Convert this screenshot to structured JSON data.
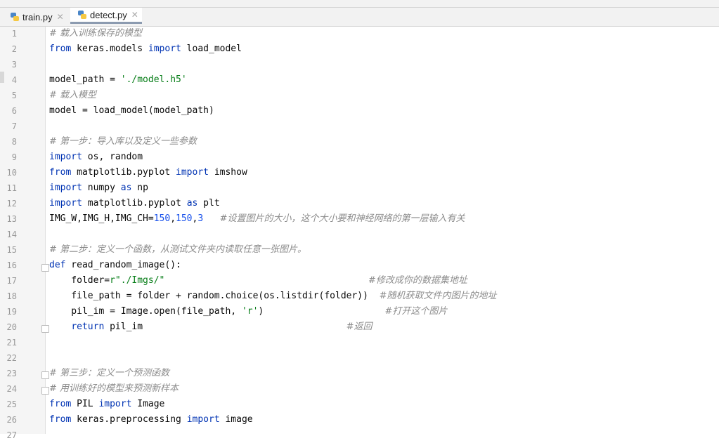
{
  "tabs": [
    {
      "label": "train.py",
      "active": false
    },
    {
      "label": "detect.py",
      "active": true
    }
  ],
  "editor": {
    "lines": [
      {
        "n": "1",
        "tokens": [
          {
            "t": "# 载入训练保存的模型",
            "c": "cm"
          }
        ]
      },
      {
        "n": "2",
        "tokens": [
          {
            "t": "from",
            "c": "kw"
          },
          {
            "t": " keras.models ",
            "c": ""
          },
          {
            "t": "import",
            "c": "kw"
          },
          {
            "t": " load_model",
            "c": ""
          }
        ]
      },
      {
        "n": "3",
        "tokens": []
      },
      {
        "n": "4",
        "tokens": [
          {
            "t": "model_path = ",
            "c": ""
          },
          {
            "t": "'./model.h5'",
            "c": "str"
          }
        ]
      },
      {
        "n": "5",
        "tokens": [
          {
            "t": "# 载入模型",
            "c": "cm"
          }
        ]
      },
      {
        "n": "6",
        "tokens": [
          {
            "t": "model = load_model(model_path)",
            "c": ""
          }
        ]
      },
      {
        "n": "7",
        "tokens": []
      },
      {
        "n": "8",
        "tokens": [
          {
            "t": "# 第一步：导入库以及定义一些参数",
            "c": "cm"
          }
        ]
      },
      {
        "n": "9",
        "tokens": [
          {
            "t": "import",
            "c": "kw"
          },
          {
            "t": " os, random",
            "c": ""
          }
        ]
      },
      {
        "n": "10",
        "tokens": [
          {
            "t": "from",
            "c": "kw"
          },
          {
            "t": " matplotlib.pyplot ",
            "c": ""
          },
          {
            "t": "import",
            "c": "kw"
          },
          {
            "t": " imshow",
            "c": ""
          }
        ]
      },
      {
        "n": "11",
        "tokens": [
          {
            "t": "import",
            "c": "kw"
          },
          {
            "t": " numpy ",
            "c": ""
          },
          {
            "t": "as",
            "c": "kw"
          },
          {
            "t": " np",
            "c": ""
          }
        ]
      },
      {
        "n": "12",
        "tokens": [
          {
            "t": "import",
            "c": "kw"
          },
          {
            "t": " matplotlib.pyplot ",
            "c": ""
          },
          {
            "t": "as",
            "c": "kw"
          },
          {
            "t": " plt",
            "c": ""
          }
        ]
      },
      {
        "n": "13",
        "tokens": [
          {
            "t": "IMG_W,IMG_H,IMG_CH=",
            "c": ""
          },
          {
            "t": "150",
            "c": "num"
          },
          {
            "t": ",",
            "c": ""
          },
          {
            "t": "150",
            "c": "num"
          },
          {
            "t": ",",
            "c": ""
          },
          {
            "t": "3",
            "c": "num"
          },
          {
            "t": "   ",
            "c": ""
          },
          {
            "t": "#设置图片的大小，这个大小要和神经网络的第一层输入有关",
            "c": "cm"
          }
        ]
      },
      {
        "n": "14",
        "tokens": []
      },
      {
        "n": "15",
        "tokens": [
          {
            "t": "# 第二步：定义一个函数，从测试文件夹内读取任意一张图片。",
            "c": "cm"
          }
        ]
      },
      {
        "n": "16",
        "tokens": [
          {
            "t": "def",
            "c": "kw"
          },
          {
            "t": " read_random_image():",
            "c": ""
          }
        ]
      },
      {
        "n": "17",
        "tokens": [
          {
            "t": "    folder=",
            "c": ""
          },
          {
            "t": "r\"./Imgs/\"",
            "c": "str"
          },
          {
            "t": "                                     ",
            "c": ""
          },
          {
            "t": "#修改成你的数据集地址",
            "c": "cm"
          }
        ]
      },
      {
        "n": "18",
        "tokens": [
          {
            "t": "    file_path = folder + random.choice(os.listdir(folder))  ",
            "c": ""
          },
          {
            "t": "#随机获取文件内图片的地址",
            "c": "cm"
          }
        ]
      },
      {
        "n": "19",
        "tokens": [
          {
            "t": "    pil_im = Image.open(file_path, ",
            "c": ""
          },
          {
            "t": "'r'",
            "c": "str"
          },
          {
            "t": ")                      ",
            "c": ""
          },
          {
            "t": "#打开这个图片",
            "c": "cm"
          }
        ]
      },
      {
        "n": "20",
        "tokens": [
          {
            "t": "    ",
            "c": ""
          },
          {
            "t": "return",
            "c": "kw"
          },
          {
            "t": " pil_im                                     ",
            "c": ""
          },
          {
            "t": "#返回",
            "c": "cm"
          }
        ]
      },
      {
        "n": "21",
        "tokens": []
      },
      {
        "n": "22",
        "tokens": []
      },
      {
        "n": "23",
        "tokens": [
          {
            "t": "# 第三步：定义一个预测函数",
            "c": "cm"
          }
        ]
      },
      {
        "n": "24",
        "tokens": [
          {
            "t": "# 用训练好的模型来预测新样本",
            "c": "cm"
          }
        ]
      },
      {
        "n": "25",
        "tokens": [
          {
            "t": "from",
            "c": "kw"
          },
          {
            "t": " PIL ",
            "c": ""
          },
          {
            "t": "import",
            "c": "kw"
          },
          {
            "t": " Image",
            "c": ""
          }
        ]
      },
      {
        "n": "26",
        "tokens": [
          {
            "t": "from",
            "c": "kw"
          },
          {
            "t": " keras.preprocessing ",
            "c": ""
          },
          {
            "t": "import",
            "c": "kw"
          },
          {
            "t": " image",
            "c": ""
          }
        ]
      },
      {
        "n": "27",
        "tokens": []
      }
    ]
  },
  "colors": {
    "keyword": "#0033b3",
    "string": "#067d17",
    "number": "#1750eb",
    "comment": "#8c8c8c"
  }
}
